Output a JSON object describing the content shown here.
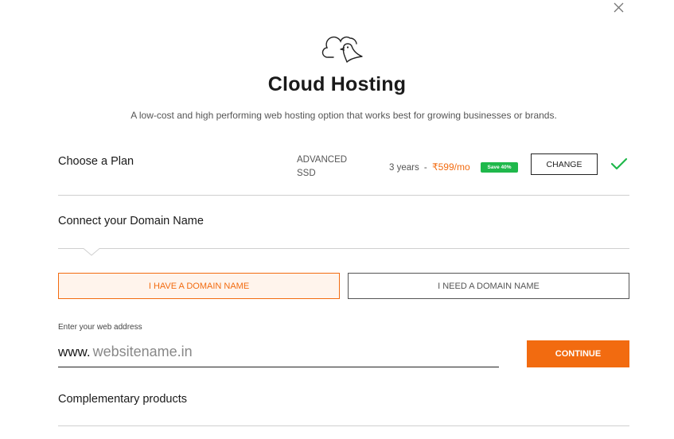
{
  "header": {
    "close_icon": "close-icon",
    "hero_icon": "cloud-bird-icon",
    "title": "Cloud Hosting",
    "subtitle": "A low-cost and high performing web hosting option that works best for growing businesses or brands."
  },
  "plan": {
    "section_label": "Choose a Plan",
    "name_line1": "ADVANCED",
    "name_line2": "SSD",
    "duration": "3 years",
    "separator": "-",
    "price": "₹599/mo",
    "save_badge": "Save 40%",
    "change_label": "CHANGE",
    "status_icon": "check-icon"
  },
  "domain": {
    "section_label": "Connect your Domain Name",
    "tabs": [
      {
        "label": "I HAVE A DOMAIN NAME",
        "selected": true
      },
      {
        "label": "I NEED A DOMAIN NAME",
        "selected": false
      }
    ],
    "address_label": "Enter your web address",
    "address_prefix": "www.",
    "address_placeholder": "websitename.in",
    "continue_label": "CONTINUE"
  },
  "complementary": {
    "section_label": "Complementary products"
  },
  "colors": {
    "accent": "#f26b10",
    "accent_bg": "#fff4ec",
    "save_badge": "#1fb84b",
    "check": "#1fb84b"
  }
}
